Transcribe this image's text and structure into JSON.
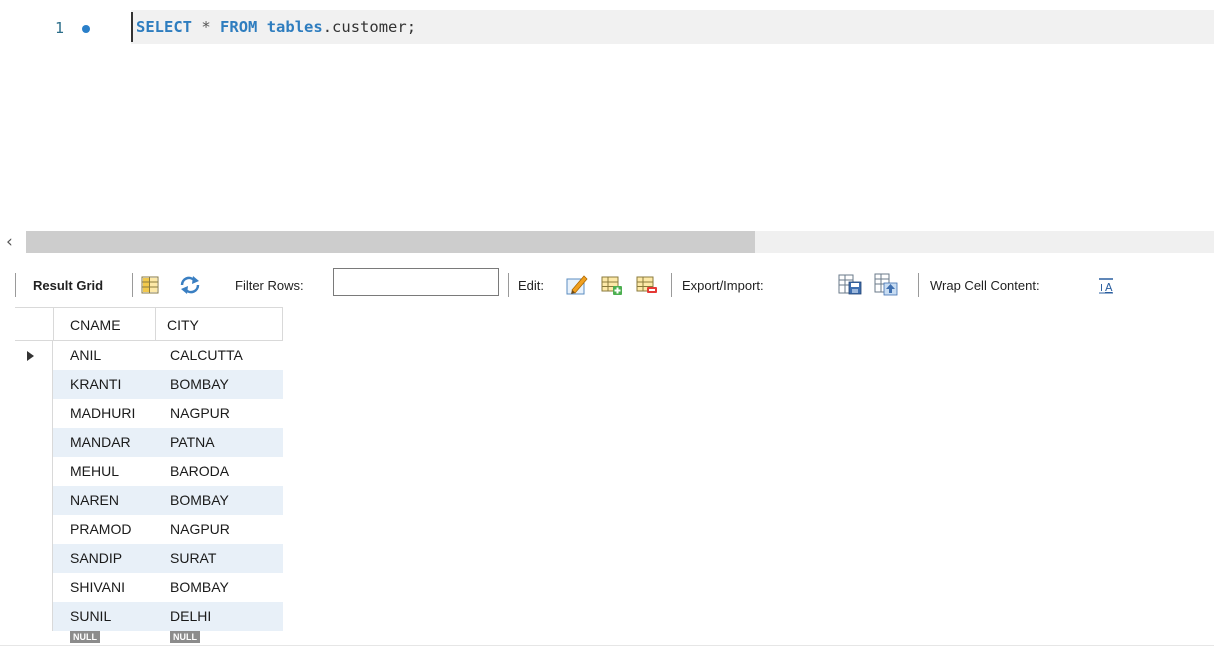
{
  "editor": {
    "line_number": "1",
    "code_tokens": {
      "select": "SELECT",
      "star": "*",
      "from": "FROM",
      "schema": "tables",
      "rest": ".customer;"
    }
  },
  "toolbar": {
    "result_grid_label": "Result Grid",
    "filter_rows_label": "Filter Rows:",
    "filter_rows_value": "",
    "edit_label": "Edit:",
    "export_import_label": "Export/Import:",
    "wrap_cell_label": "Wrap Cell Content:"
  },
  "grid": {
    "columns": [
      "CNAME",
      "CITY"
    ],
    "rows": [
      [
        "ANIL",
        "CALCUTTA"
      ],
      [
        "KRANTI",
        "BOMBAY"
      ],
      [
        "MADHURI",
        "NAGPUR"
      ],
      [
        "MANDAR",
        "PATNA"
      ],
      [
        "MEHUL",
        "BARODA"
      ],
      [
        "NAREN",
        "BOMBAY"
      ],
      [
        "PRAMOD",
        "NAGPUR"
      ],
      [
        "SANDIP",
        "SURAT"
      ],
      [
        "SHIVANI",
        "BOMBAY"
      ],
      [
        "SUNIL",
        "DELHI"
      ]
    ],
    "null_label": "NULL",
    "selected_row": 0
  },
  "colors": {
    "keyword": "#2e7dbf",
    "alt_row": "#e8f0f8",
    "editor_current_line": "#f1f1f1"
  }
}
